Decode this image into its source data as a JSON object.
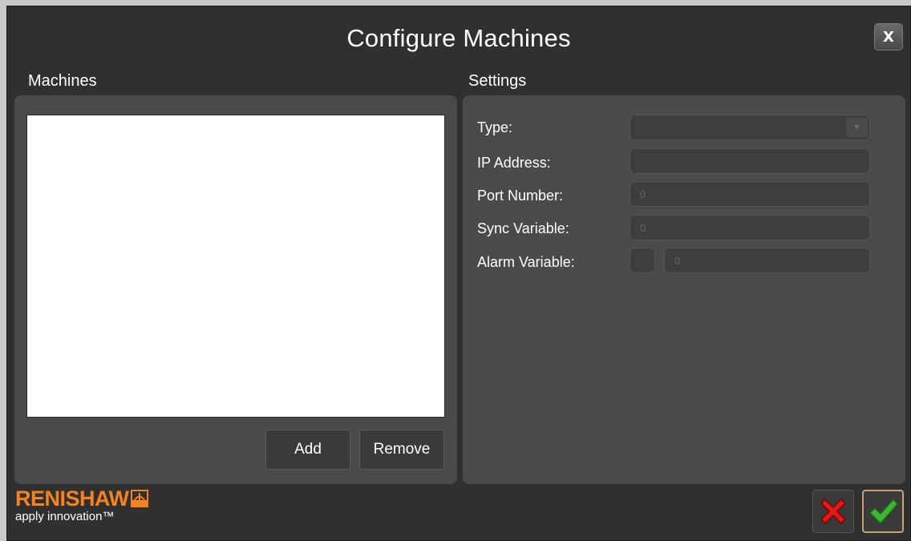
{
  "dialog": {
    "title": "Configure Machines",
    "close_label": "X"
  },
  "machines": {
    "section_label": "Machines",
    "add_label": "Add",
    "remove_label": "Remove"
  },
  "settings": {
    "section_label": "Settings",
    "type_label": "Type:",
    "type_value": "",
    "ip_label": "IP Address:",
    "ip_value": "",
    "port_label": "Port Number:",
    "port_value": "0",
    "sync_label": "Sync Variable:",
    "sync_value": "0",
    "alarm_label": "Alarm Variable:",
    "alarm_value": "0"
  },
  "branding": {
    "logo_text": "RENISHAW",
    "tagline": "apply innovation™"
  },
  "icons": {
    "dropdown": "chevron-down-icon",
    "cancel": "red-x-icon",
    "confirm": "green-check-icon"
  },
  "colors": {
    "brand_orange": "#f58220",
    "cancel_red": "#e01a1a",
    "confirm_green": "#3cb531"
  }
}
